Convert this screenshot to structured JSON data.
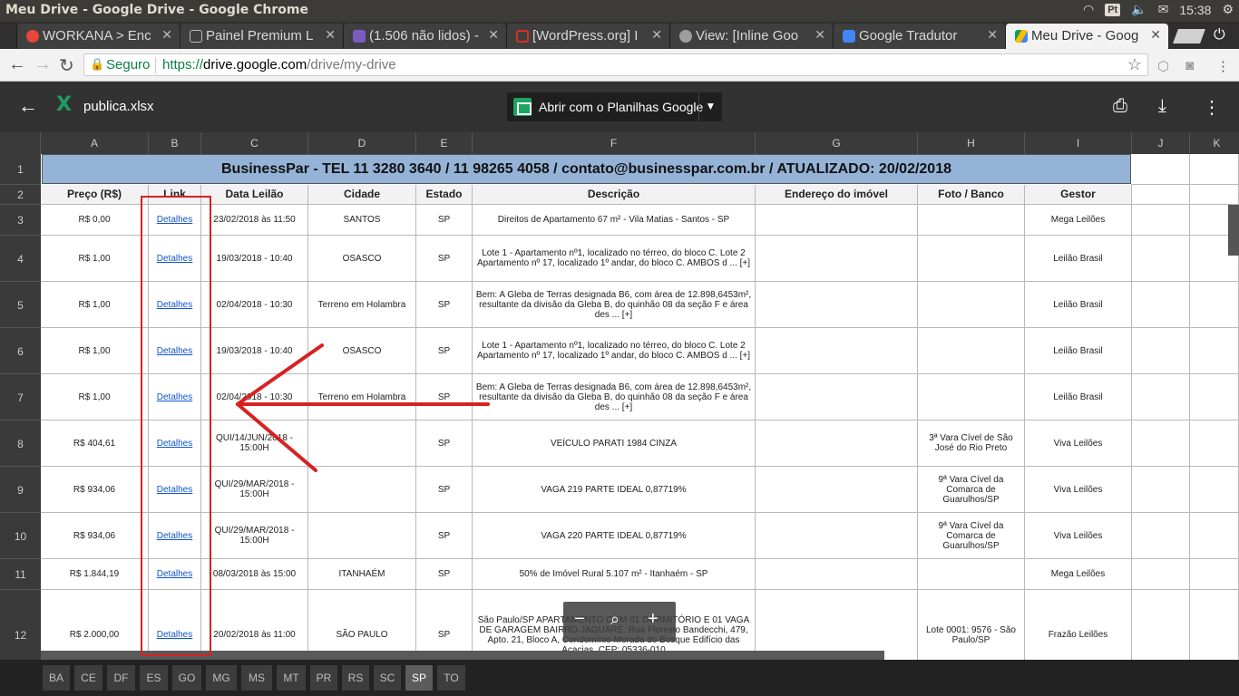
{
  "os": {
    "window_title": "Meu Drive - Google Drive - Google Chrome",
    "lang": "Pt",
    "clock": "15:38"
  },
  "tabs": [
    {
      "label": "WORKANA > Enc",
      "color": "#e8453c"
    },
    {
      "label": "Painel Premium L",
      "color": "#9e9e9e"
    },
    {
      "label": "(1.506 não lidos) -",
      "color": "#7b5bbf"
    },
    {
      "label": "[WordPress.org] I",
      "color": "#d93025"
    },
    {
      "label": "View: [Inline Goo",
      "color": "#9e9e9e"
    },
    {
      "label": "Google Tradutor",
      "color": "#4285f4"
    },
    {
      "label": "Meu Drive - Goog",
      "color": "#fbbc04"
    }
  ],
  "toolbar": {
    "secure": "Seguro",
    "url_scheme": "https://",
    "url_host": "drive.google.com",
    "url_path": "/drive/my-drive"
  },
  "viewer": {
    "filename": "publica.xlsx",
    "open_with": "Abrir com o Planilhas Google"
  },
  "columns": [
    "A",
    "B",
    "C",
    "D",
    "E",
    "F",
    "G",
    "H",
    "I",
    "J",
    "K"
  ],
  "banner": "BusinessPar  - TEL  11 3280 3640  /   11 98265 4058  / contato@businesspar.com.br  / ATUALIZADO: 20/02/2018",
  "headers": [
    "Preço (R$)",
    "Link",
    "Data Leilão",
    "Cidade",
    "Estado",
    "Descrição",
    "Endereço do imóvel",
    "Foto / Banco",
    "Gestor"
  ],
  "rows": [
    {
      "num": "3",
      "preco": "R$ 0,00",
      "link": "Detalhes",
      "data": "23/02/2018 às 11:50",
      "cidade": "SANTOS",
      "estado": "SP",
      "desc": "Direitos de Apartamento 67 m² - Vila Matias - Santos - SP",
      "end": "",
      "foto": "",
      "gestor": "Mega Leilões"
    },
    {
      "num": "4",
      "preco": "R$ 1,00",
      "link": "Detalhes",
      "data": "19/03/2018 - 10:40",
      "cidade": "OSASCO",
      "estado": "SP",
      "desc": "Lote 1 - Apartamento nº1, localizado no térreo, do bloco C. Lote 2 Apartamento nº 17, localizado 1º andar, do bloco C. AMBOS d ... [+]",
      "end": "",
      "foto": "",
      "gestor": "Leilão Brasil"
    },
    {
      "num": "5",
      "preco": "R$ 1,00",
      "link": "Detalhes",
      "data": "02/04/2018 - 10:30",
      "cidade": "Terreno em Holambra",
      "estado": "SP",
      "desc": "Bem: A Gleba de Terras designada B6, com área de 12.898,6453m², resultante da divisão da Gleba B, do quinhão 08 da seção F e área des ... [+]",
      "end": "",
      "foto": "",
      "gestor": "Leilão Brasil"
    },
    {
      "num": "6",
      "preco": "R$ 1,00",
      "link": "Detalhes",
      "data": "19/03/2018 - 10:40",
      "cidade": "OSASCO",
      "estado": "SP",
      "desc": "Lote 1 - Apartamento nº1, localizado no térreo, do bloco C. Lote 2 Apartamento nº 17, localizado 1º andar, do bloco C. AMBOS d ... [+]",
      "end": "",
      "foto": "",
      "gestor": "Leilão Brasil"
    },
    {
      "num": "7",
      "preco": "R$ 1,00",
      "link": "Detalhes",
      "data": "02/04/2018 - 10:30",
      "cidade": "Terreno em Holambra",
      "estado": "SP",
      "desc": "Bem: A Gleba de Terras designada B6, com área de 12.898,6453m², resultante da divisão da Gleba B, do quinhão 08 da seção F e área des ... [+]",
      "end": "",
      "foto": "",
      "gestor": "Leilão Brasil"
    },
    {
      "num": "8",
      "preco": "R$ 404,61",
      "link": "Detalhes",
      "data": "QUI/14/JUN/2018 - 15:00H",
      "cidade": "",
      "estado": "SP",
      "desc": "VEÍCULO PARATI 1984 CINZA",
      "end": "",
      "foto": "3ª Vara Cível de São José do Rio Preto",
      "gestor": "Viva Leilões"
    },
    {
      "num": "9",
      "preco": "R$ 934,06",
      "link": "Detalhes",
      "data": "QUI/29/MAR/2018 - 15:00H",
      "cidade": "",
      "estado": "SP",
      "desc": "VAGA 219 PARTE IDEAL 0,87719%",
      "end": "",
      "foto": "9ª Vara Cível da Comarca de Guarulhos/SP",
      "gestor": "Viva Leilões"
    },
    {
      "num": "10",
      "preco": "R$ 934,06",
      "link": "Detalhes",
      "data": "QUI/29/MAR/2018 - 15:00H",
      "cidade": "",
      "estado": "SP",
      "desc": "VAGA 220 PARTE IDEAL 0,87719%",
      "end": "",
      "foto": "9ª Vara Cível da Comarca de Guarulhos/SP",
      "gestor": "Viva Leilões"
    },
    {
      "num": "11",
      "preco": "R$ 1.844,19",
      "link": "Detalhes",
      "data": "08/03/2018 às 15:00",
      "cidade": "ITANHAÉM",
      "estado": "SP",
      "desc": "50% de Imóvel Rural 5.107 m² - Itanhaém - SP",
      "end": "",
      "foto": "",
      "gestor": "Mega Leilões"
    },
    {
      "num": "12",
      "preco": "R$ 2.000,00",
      "link": "Detalhes",
      "data": "20/02/2018 às 11:00",
      "cidade": "SÃO PAULO",
      "estado": "SP",
      "desc": "São Paulo/SP APARTAMENTO COM 01 DORMITÓRIO E 01 VAGA DE GARAGEM BAIRRO JAGUARÉ. Rua Floresto Bandecchi, 479, Apto. 21, Bloco A, Condomínio Morada do Bosque Edifício das Acacias, CEP: 05336-010",
      "end": "",
      "foto": "Lote 0001: 9576 - São Paulo/SP",
      "gestor": "Frazão Leilões"
    }
  ],
  "sheet_tabs": [
    "BA",
    "CE",
    "DF",
    "ES",
    "GO",
    "MG",
    "MS",
    "MT",
    "PR",
    "RS",
    "SC",
    "SP",
    "TO"
  ],
  "active_sheet": "SP",
  "annotation_color": "#d62222"
}
